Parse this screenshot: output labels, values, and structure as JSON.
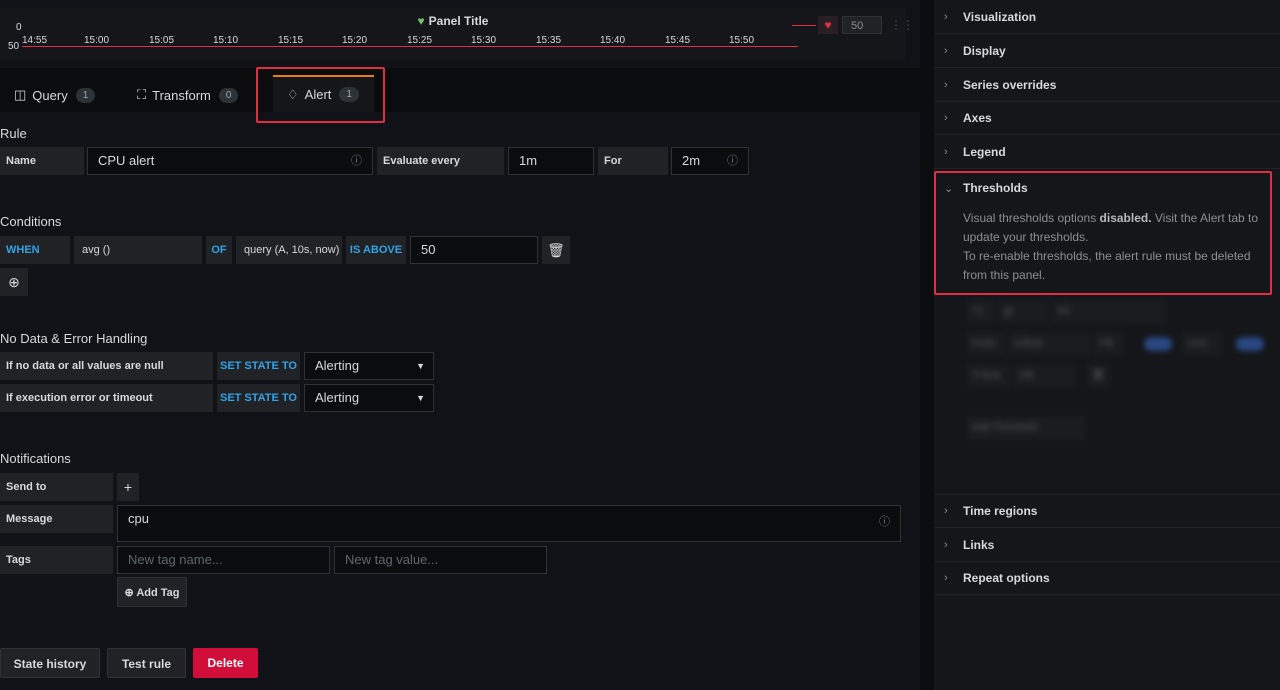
{
  "graph": {
    "title": "Panel Title",
    "y_top": "0",
    "y_bottom": "50",
    "x_ticks": [
      "14:55",
      "15:00",
      "15:05",
      "15:10",
      "15:15",
      "15:20",
      "15:25",
      "15:30",
      "15:35",
      "15:40",
      "15:45",
      "15:50"
    ],
    "legend_value": "50",
    "threshold_color": "#e02f44",
    "heart_color": "#73bf69"
  },
  "tabs": [
    {
      "label": "Query",
      "count": "1"
    },
    {
      "label": "Transform",
      "count": "0"
    },
    {
      "label": "Alert",
      "count": "1"
    }
  ],
  "rule": {
    "section": "Rule",
    "name_label": "Name",
    "name_value": "CPU alert",
    "evaluate_label": "Evaluate every",
    "evaluate_value": "1m",
    "for_label": "For",
    "for_value": "2m"
  },
  "conditions": {
    "section": "Conditions",
    "when": "WHEN",
    "reducer": "avg ()",
    "of": "OF",
    "query": "query (A, 10s, now)",
    "evaluator": "IS ABOVE",
    "threshold": "50"
  },
  "nodata": {
    "section": "No Data & Error Handling",
    "row1_label": "If no data or all values are null",
    "row2_label": "If execution error or timeout",
    "set_state": "SET STATE TO",
    "row1_value": "Alerting",
    "row2_value": "Alerting"
  },
  "notifications": {
    "section": "Notifications",
    "send_to": "Send to",
    "message_label": "Message",
    "message_value": "cpu",
    "tags_label": "Tags",
    "tag_name_placeholder": "New tag name...",
    "tag_value_placeholder": "New tag value...",
    "add_tag": "Add Tag"
  },
  "buttons": {
    "state_history": "State history",
    "test_rule": "Test rule",
    "delete": "Delete"
  },
  "options": {
    "visualization": "Visualization",
    "display": "Display",
    "series_overrides": "Series overrides",
    "axes": "Axes",
    "legend": "Legend",
    "thresholds": "Thresholds",
    "thresholds_msg_1": "Visual thresholds options ",
    "thresholds_msg_bold": "disabled.",
    "thresholds_msg_2": " Visit the Alert tab to update your thresholds.",
    "thresholds_msg_3": "To re-enable thresholds, the alert rule must be deleted from this panel.",
    "blurred_t1": "T1",
    "blurred_op": "gt",
    "blurred_val": "50",
    "blurred_color_label": "Color",
    "blurred_color_value": "critical",
    "blurred_fill": "Fill",
    "blurred_line": "Line",
    "blurred_yaxis_label": "Y-Axis",
    "blurred_yaxis_value": "left",
    "blurred_add": "Add Threshold",
    "time_regions": "Time regions",
    "links": "Links",
    "repeat_options": "Repeat options"
  }
}
